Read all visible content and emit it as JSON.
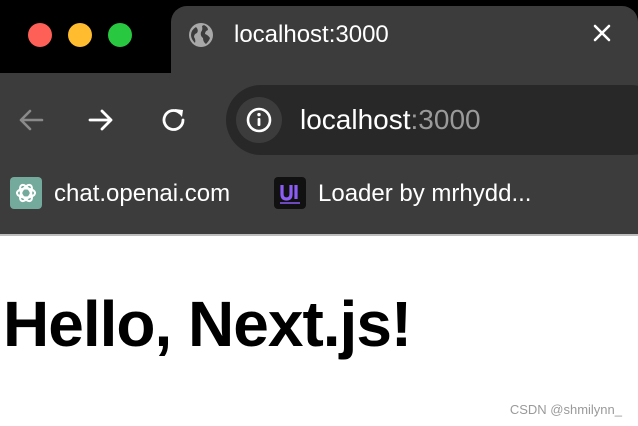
{
  "window": {
    "controls": {
      "close_color": "#fe5f57",
      "minimize_color": "#febc2e",
      "maximize_color": "#28c840"
    }
  },
  "tab": {
    "title": "localhost:3000",
    "favicon": "globe-icon",
    "close_icon": "close-icon"
  },
  "toolbar": {
    "back_icon": "arrow-left-icon",
    "back_enabled": false,
    "forward_icon": "arrow-right-icon",
    "reload_icon": "reload-icon",
    "omnibox": {
      "site_info_icon": "info-icon",
      "url_host": "localhost",
      "url_port": ":3000"
    }
  },
  "bookmarks": [
    {
      "label": "chat.openai.com",
      "icon": "openai-icon",
      "icon_color": "#74aa9c"
    },
    {
      "label": "Loader by mrhydd...",
      "icon": "ui-logo-icon",
      "icon_color": "#8b5cf6"
    }
  ],
  "page": {
    "heading": "Hello, Next.js!"
  },
  "watermark": "CSDN @shmilynn_",
  "colors": {
    "chrome_dark": "#3c3c3c",
    "tabstrip": "#000000",
    "omnibox": "#282828"
  }
}
